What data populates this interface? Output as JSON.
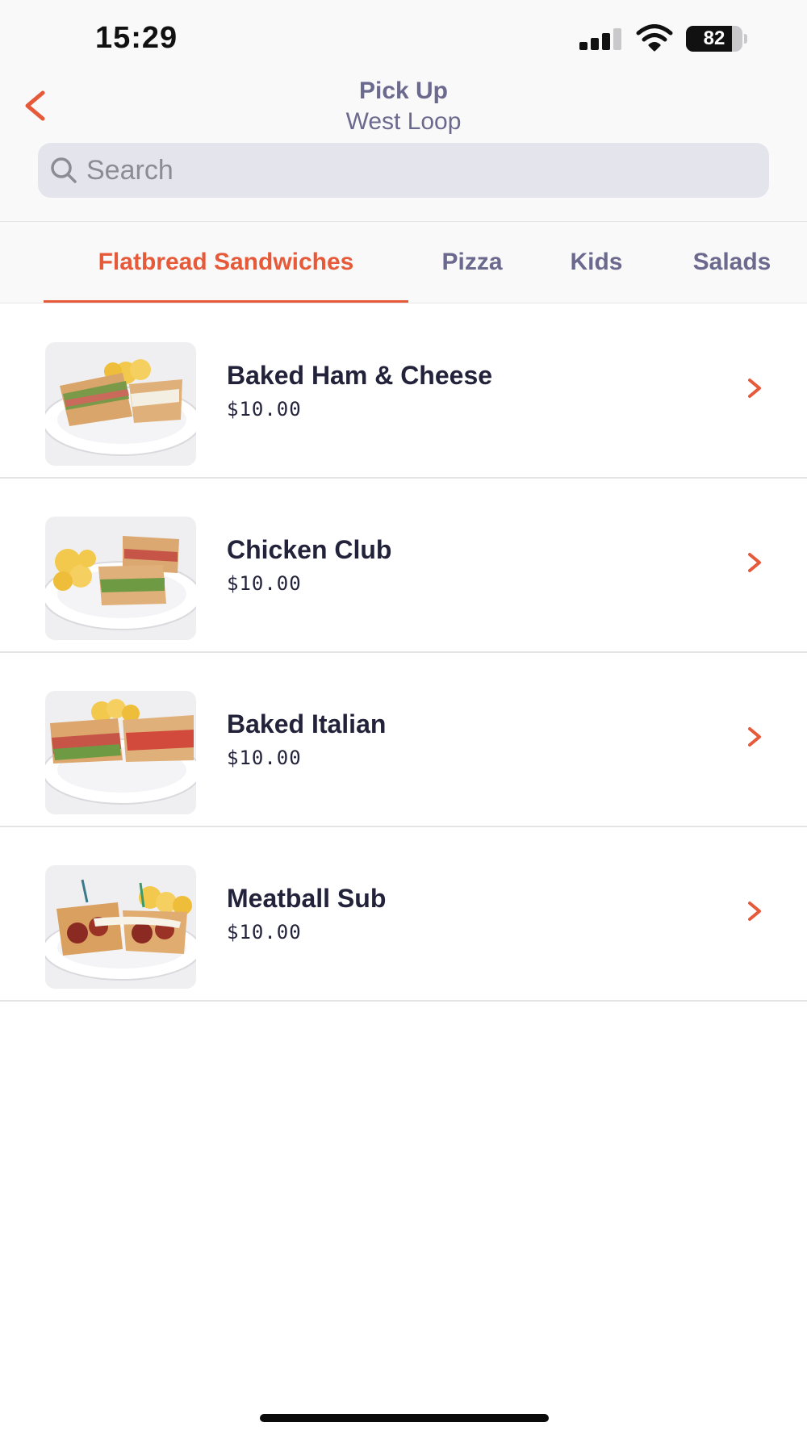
{
  "status_bar": {
    "time": "15:29",
    "battery_percent": "82",
    "battery_level": 0.82
  },
  "header": {
    "title": "Pick Up",
    "subtitle": "West Loop"
  },
  "search": {
    "placeholder": "Search",
    "value": ""
  },
  "tabs": [
    {
      "label": "Flatbread Sandwiches",
      "active": true
    },
    {
      "label": "Pizza",
      "active": false
    },
    {
      "label": "Kids",
      "active": false
    },
    {
      "label": "Salads",
      "active": false
    }
  ],
  "menu_items": [
    {
      "name": "Baked Ham & Cheese",
      "price": "$10.00"
    },
    {
      "name": "Chicken Club",
      "price": "$10.00"
    },
    {
      "name": "Baked Italian",
      "price": "$10.00"
    },
    {
      "name": "Meatball Sub",
      "price": "$10.00"
    }
  ],
  "colors": {
    "accent": "#e65a3a",
    "muted_text": "#6b6a8e",
    "search_bg": "#e4e4ec",
    "text": "#22223a"
  }
}
